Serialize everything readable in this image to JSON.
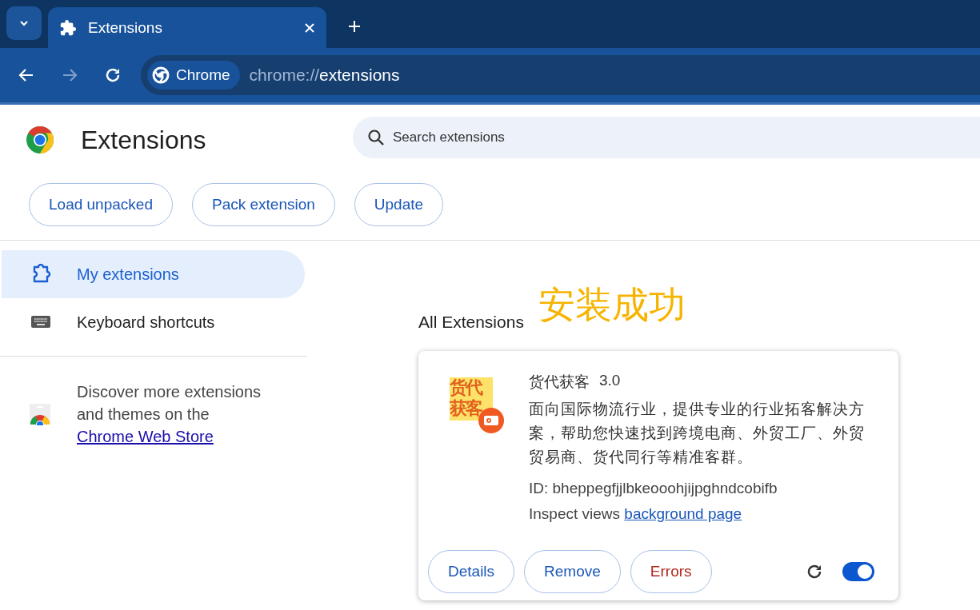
{
  "browser": {
    "tab": {
      "title": "Extensions",
      "selected": true
    },
    "address": {
      "chip": "Chrome",
      "scheme": "chrome://",
      "path": "extensions"
    },
    "forward_disabled": true
  },
  "header": {
    "title": "Extensions",
    "search": {
      "placeholder": "Search extensions"
    }
  },
  "actions": [
    "Load unpacked",
    "Pack extension",
    "Update"
  ],
  "sidebar": {
    "items": [
      {
        "kind": "puzzle",
        "label": "My extensions",
        "selected": true
      },
      {
        "kind": "keyboard",
        "label": "Keyboard shortcuts",
        "selected": false
      }
    ],
    "store": {
      "text": "Discover more extensions and themes on the ",
      "link": "Chrome Web Store"
    }
  },
  "section_title": "All Extensions",
  "annotation": "安装成功",
  "extension": {
    "logo_text": "货代获客",
    "name": "货代获客",
    "version": "3.0",
    "description": "面向国际物流行业，提供专业的行业拓客解决方案，帮助您快速找到跨境电商、外贸工厂、外贸贸易商、货代同行等精准客群。",
    "id": "ID: bheppegfjjlbkeooohjijpghndcobifb",
    "inspect_label": "Inspect views ",
    "inspect_link": "background page",
    "buttons": [
      {
        "kind": "normal",
        "label": "Details"
      },
      {
        "kind": "normal",
        "label": "Remove"
      },
      {
        "kind": "error",
        "label": "Errors"
      }
    ],
    "enabled": true
  }
}
